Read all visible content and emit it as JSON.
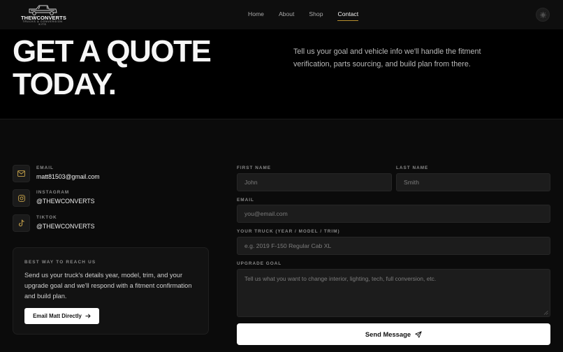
{
  "brand": {
    "name": "THEWCONVERTS",
    "tagline": "TRUCKS & CONVERSION KITS"
  },
  "nav": {
    "items": [
      "Home",
      "About",
      "Shop",
      "Contact"
    ],
    "active": "Contact"
  },
  "hero": {
    "title_line1": "GET A QUOTE",
    "title_line2": "TODAY.",
    "description": "Tell us your goal and vehicle info we'll handle the fitment verification, parts sourcing, and build plan from there."
  },
  "contacts": [
    {
      "label": "EMAIL",
      "value": "matt81503@gmail.com",
      "icon": "mail-icon"
    },
    {
      "label": "INSTAGRAM",
      "value": "@THEWCONVERTS",
      "icon": "instagram-icon"
    },
    {
      "label": "TIKTOK",
      "value": "@THEWCONVERTS",
      "icon": "tiktok-icon"
    }
  ],
  "reach": {
    "title": "BEST WAY TO REACH US",
    "text": "Send us your truck's details year, model, trim, and your upgrade goal and we'll respond with a fitment confirmation and build plan.",
    "button": "Email Matt Directly"
  },
  "form": {
    "first_name": {
      "label": "FIRST NAME",
      "placeholder": "John"
    },
    "last_name": {
      "label": "LAST NAME",
      "placeholder": "Smith"
    },
    "email": {
      "label": "EMAIL",
      "placeholder": "you@email.com"
    },
    "truck": {
      "label": "YOUR TRUCK (YEAR / MODEL / TRIM)",
      "placeholder": "e.g. 2019 F-150 Regular Cab XL"
    },
    "goal": {
      "label": "UPGRADE GOAL",
      "placeholder": "Tell us what you want to change   interior, lighting, tech, full conversion, etc."
    },
    "submit": "Send Message"
  },
  "colors": {
    "accent": "#b7902f",
    "background": "#0b0b0b",
    "hero_background": "#000000"
  }
}
